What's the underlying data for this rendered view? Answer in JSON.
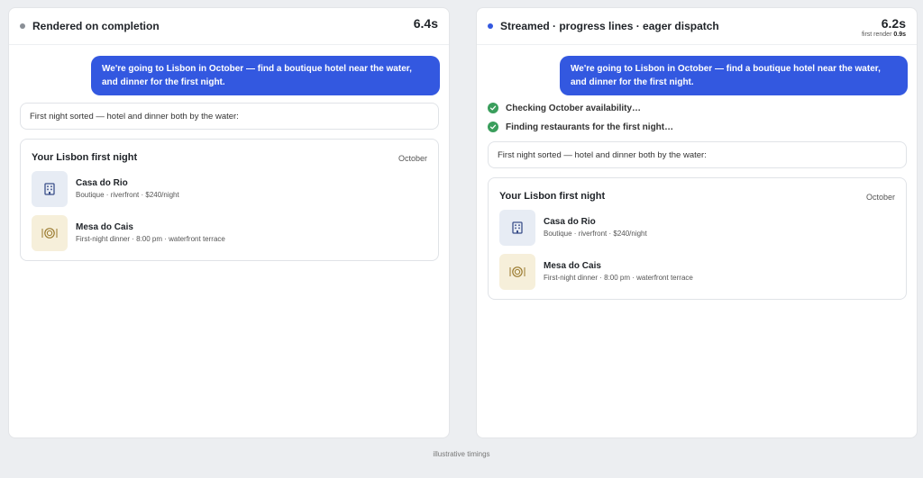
{
  "left": {
    "title": "Rendered on completion",
    "dot_color": "#8a8f96",
    "timing": "6.4s",
    "user_message": "We're going to Lisbon in October — find a boutique hotel near the water, and dinner for the first night.",
    "reply": "First night sorted — hotel and dinner both by the water:",
    "card": {
      "title": "Your Lisbon first night",
      "month": "October",
      "items": [
        {
          "name": "Casa do Rio",
          "desc": "Boutique · riverfront · $240/night",
          "icon": "hotel-icon"
        },
        {
          "name": "Mesa do Cais",
          "desc": "First-night dinner · 8:00 pm · waterfront terrace",
          "icon": "dinner-plate-icon"
        }
      ]
    }
  },
  "right": {
    "title": "Streamed · progress lines · eager dispatch",
    "dot_color": "#3358e0",
    "timing": "6.2s",
    "first_render_label": "first render",
    "first_render_value": "0.9s",
    "user_message": "We're going to Lisbon in October — find a boutique hotel near the water, and dinner for the first night.",
    "progress": [
      "Checking October availability…",
      "Finding restaurants for the first night…"
    ],
    "reply": "First night sorted — hotel and dinner both by the water:",
    "card": {
      "title": "Your Lisbon first night",
      "month": "October",
      "items": [
        {
          "name": "Casa do Rio",
          "desc": "Boutique · riverfront · $240/night",
          "icon": "hotel-icon"
        },
        {
          "name": "Mesa do Cais",
          "desc": "First-night dinner · 8:00 pm · waterfront terrace",
          "icon": "dinner-plate-icon"
        }
      ]
    }
  },
  "footnote": "illustrative timings",
  "colors": {
    "accent": "#3358e0",
    "success": "#3a9e5c"
  }
}
